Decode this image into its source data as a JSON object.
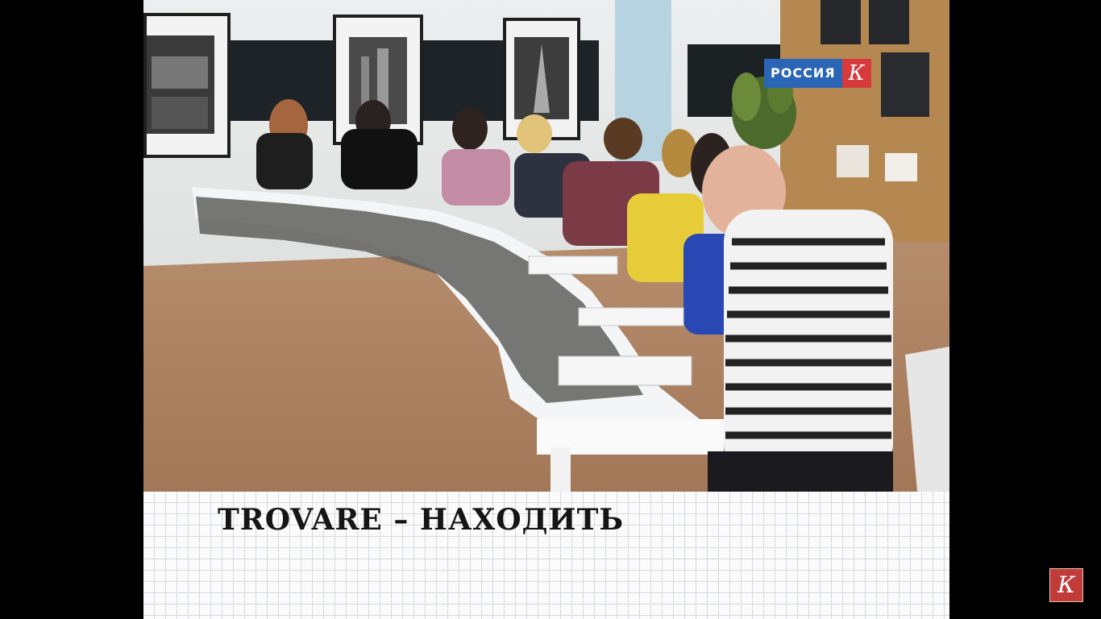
{
  "video": {
    "caption": "TROVARE – НАХОДИТЬ",
    "channel_logo_text": "РОССИЯ",
    "channel_logo_letter": "К",
    "corner_logo_letter": "К"
  },
  "colors": {
    "channel_blue": "#2b66b6",
    "channel_red": "#d63a3a",
    "corner_logo_red": "#c23b3b",
    "letterbox": "#000000",
    "caption_grid": "#d6d9de"
  }
}
